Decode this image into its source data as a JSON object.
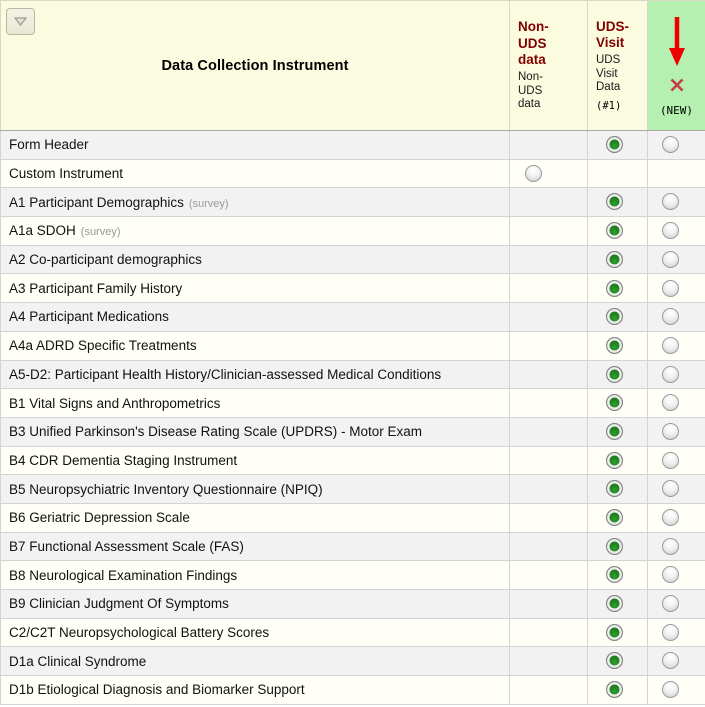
{
  "survey_tag": "(survey)",
  "header": {
    "collapse_button_icon": "chevron-down-icon",
    "instrument_col_label": "Data Collection Instrument",
    "columns": [
      {
        "title": "Non-UDS data",
        "subtitle": "Non-UDS data"
      },
      {
        "title": "UDS-Visit",
        "subtitle": "UDS Visit Data",
        "number": "(#1)"
      },
      {
        "icons": [
          "red-arrow-down-icon",
          "red-x-icon"
        ],
        "badge": "(NEW)"
      }
    ]
  },
  "colors": {
    "header_bg": "#fbfbe0",
    "new_column_bg": "#b5f0b0",
    "accent_maroon": "#800000",
    "arrow_red": "#ee0000",
    "x_red": "#c63b46",
    "row_odd": "#f2f2f2",
    "row_even": "#fffff7",
    "radio_selected_green": "#1d7c1d"
  },
  "rows": [
    {
      "label": "Form Header",
      "survey": false,
      "non_uds": "none",
      "uds_visit": "selected",
      "new_event": "unselected"
    },
    {
      "label": "Custom Instrument",
      "survey": false,
      "non_uds": "unselected",
      "uds_visit": "none",
      "new_event": "none"
    },
    {
      "label": "A1 Participant Demographics",
      "survey": true,
      "non_uds": "none",
      "uds_visit": "selected",
      "new_event": "unselected"
    },
    {
      "label": "A1a SDOH",
      "survey": true,
      "non_uds": "none",
      "uds_visit": "selected",
      "new_event": "unselected"
    },
    {
      "label": "A2 Co-participant demographics",
      "survey": false,
      "non_uds": "none",
      "uds_visit": "selected",
      "new_event": "unselected"
    },
    {
      "label": "A3 Participant Family History",
      "survey": false,
      "non_uds": "none",
      "uds_visit": "selected",
      "new_event": "unselected"
    },
    {
      "label": "A4 Participant Medications",
      "survey": false,
      "non_uds": "none",
      "uds_visit": "selected",
      "new_event": "unselected"
    },
    {
      "label": "A4a ADRD Specific Treatments",
      "survey": false,
      "non_uds": "none",
      "uds_visit": "selected",
      "new_event": "unselected"
    },
    {
      "label": "A5-D2: Participant Health History/Clinician-assessed Medical Conditions",
      "survey": false,
      "non_uds": "none",
      "uds_visit": "selected",
      "new_event": "unselected"
    },
    {
      "label": "B1 Vital Signs and Anthropometrics",
      "survey": false,
      "non_uds": "none",
      "uds_visit": "selected",
      "new_event": "unselected"
    },
    {
      "label": "B3 Unified Parkinson's Disease Rating Scale (UPDRS) - Motor Exam",
      "survey": false,
      "non_uds": "none",
      "uds_visit": "selected",
      "new_event": "unselected"
    },
    {
      "label": "B4 CDR Dementia Staging Instrument",
      "survey": false,
      "non_uds": "none",
      "uds_visit": "selected",
      "new_event": "unselected"
    },
    {
      "label": "B5 Neuropsychiatric Inventory Questionnaire (NPIQ)",
      "survey": false,
      "non_uds": "none",
      "uds_visit": "selected",
      "new_event": "unselected"
    },
    {
      "label": "B6 Geriatric Depression Scale",
      "survey": false,
      "non_uds": "none",
      "uds_visit": "selected",
      "new_event": "unselected"
    },
    {
      "label": "B7 Functional Assessment Scale (FAS)",
      "survey": false,
      "non_uds": "none",
      "uds_visit": "selected",
      "new_event": "unselected"
    },
    {
      "label": "B8 Neurological Examination Findings",
      "survey": false,
      "non_uds": "none",
      "uds_visit": "selected",
      "new_event": "unselected"
    },
    {
      "label": "B9 Clinician Judgment Of Symptoms",
      "survey": false,
      "non_uds": "none",
      "uds_visit": "selected",
      "new_event": "unselected"
    },
    {
      "label": "C2/C2T Neuropsychological Battery Scores",
      "survey": false,
      "non_uds": "none",
      "uds_visit": "selected",
      "new_event": "unselected"
    },
    {
      "label": "D1a Clinical Syndrome",
      "survey": false,
      "non_uds": "none",
      "uds_visit": "selected",
      "new_event": "unselected"
    },
    {
      "label": "D1b Etiological Diagnosis and Biomarker Support",
      "survey": false,
      "non_uds": "none",
      "uds_visit": "selected",
      "new_event": "unselected"
    }
  ]
}
